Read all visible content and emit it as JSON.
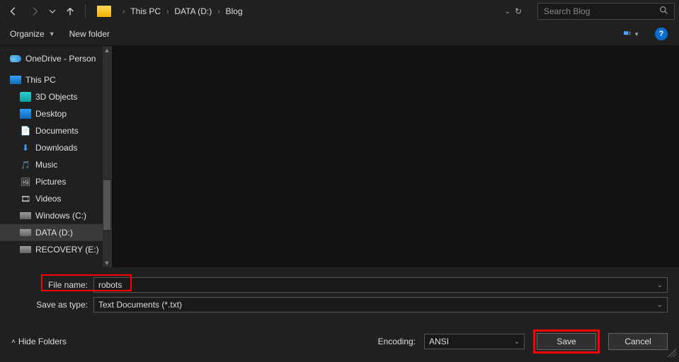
{
  "nav": {
    "back_enabled": true,
    "forward_enabled": false
  },
  "breadcrumb": {
    "parts": [
      "This PC",
      "DATA (D:)",
      "Blog"
    ]
  },
  "search": {
    "placeholder": "Search Blog"
  },
  "toolbar": {
    "organize": "Organize",
    "new_folder": "New folder"
  },
  "tree": {
    "onedrive": "OneDrive - Person",
    "this_pc": "This PC",
    "items": [
      "3D Objects",
      "Desktop",
      "Documents",
      "Downloads",
      "Music",
      "Pictures",
      "Videos",
      "Windows (C:)",
      "DATA (D:)",
      "RECOVERY (E:)"
    ],
    "selected": "DATA (D:)"
  },
  "form": {
    "file_name_label": "File name:",
    "file_name_value": "robots",
    "save_type_label": "Save as type:",
    "save_type_value": "Text Documents (*.txt)"
  },
  "bottom": {
    "hide_folders": "Hide Folders",
    "encoding_label": "Encoding:",
    "encoding_value": "ANSI",
    "save": "Save",
    "cancel": "Cancel"
  }
}
